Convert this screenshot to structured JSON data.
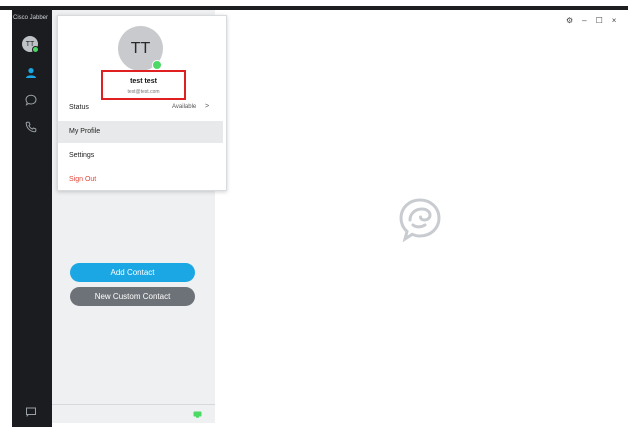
{
  "app": {
    "title": "Cisco Jabber"
  },
  "rail": {
    "avatar_initials": "TT"
  },
  "profile_menu": {
    "avatar_initials": "TT",
    "user_name": "test test",
    "user_email": "test@test.com",
    "status_label": "Status",
    "status_value": "Available",
    "status_chevron": ">",
    "items": [
      {
        "label": "My Profile"
      },
      {
        "label": "Settings"
      },
      {
        "label": "Sign Out"
      }
    ]
  },
  "contacts": {
    "add_contact_label": "Add Contact",
    "new_custom_contact_label": "New Custom Contact"
  },
  "window_controls": {
    "settings_glyph": "⚙",
    "minimize_glyph": "–",
    "maximize_glyph": "☐",
    "close_glyph": "×"
  },
  "colors": {
    "rail_background": "#1a1c1f",
    "panel_background": "#eef0f2",
    "add_contact": "#1aa7e3",
    "new_custom_contact": "#6d7278",
    "presence_available": "#4cd964",
    "sign_out": "#e0463b",
    "highlight_box": "#e02020",
    "selected_item": "#e8e9ea"
  }
}
